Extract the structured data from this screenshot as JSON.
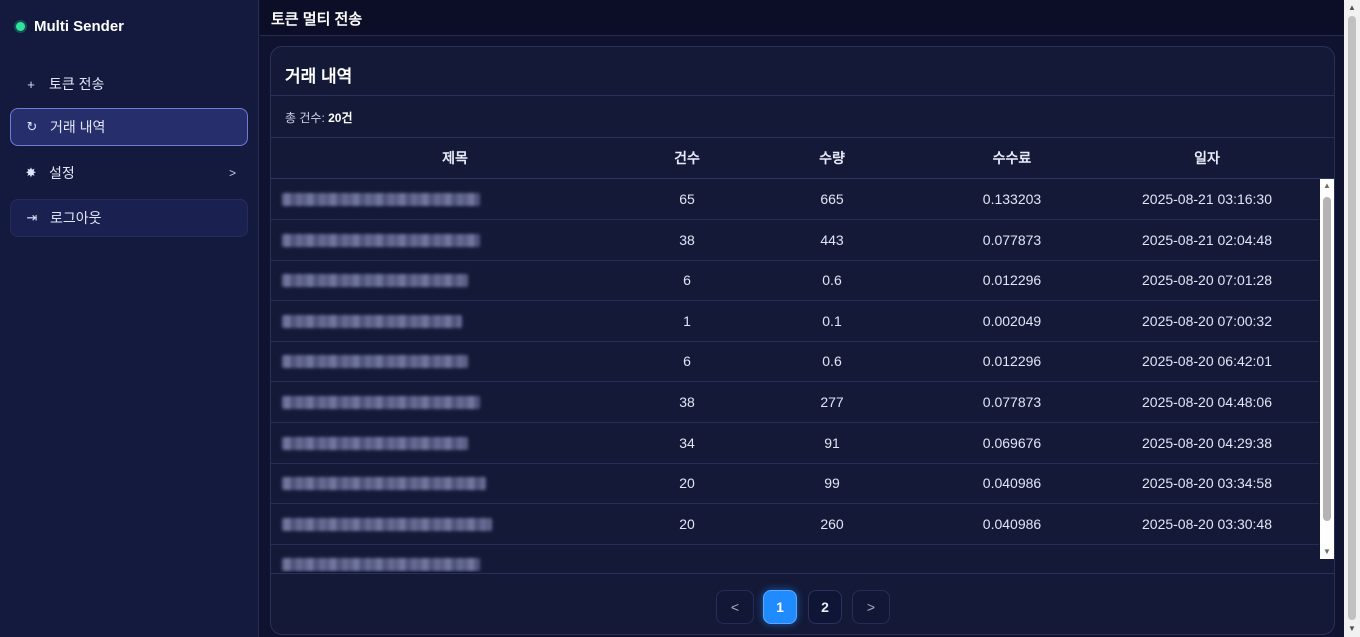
{
  "app": {
    "brand": "Multi Sender",
    "page_title": "토큰 멀티 전송"
  },
  "colors": {
    "accent": "#1f8bff",
    "status_dot": "#2ee59d",
    "background": "#0f1330"
  },
  "sidebar": {
    "items": [
      {
        "label": "토큰 전송",
        "icon": "plus-icon",
        "glyph": "+"
      },
      {
        "label": "거래 내역",
        "icon": "history-icon",
        "glyph": "↻"
      },
      {
        "label": "설정",
        "icon": "gear-icon",
        "glyph": "✸",
        "chevron": ">"
      },
      {
        "label": "로그아웃",
        "icon": "logout-icon",
        "glyph": "⇥"
      }
    ]
  },
  "history": {
    "title": "거래 내역",
    "total_label": "총 건수: ",
    "total_value": "20건",
    "columns": [
      "제목",
      "건수",
      "수량",
      "수수료",
      "일자"
    ],
    "rows": [
      {
        "count": "65",
        "amount": "665",
        "fee": "0.133203",
        "date": "2025-08-21 03:16:30"
      },
      {
        "count": "38",
        "amount": "443",
        "fee": "0.077873",
        "date": "2025-08-21 02:04:48"
      },
      {
        "count": "6",
        "amount": "0.6",
        "fee": "0.012296",
        "date": "2025-08-20 07:01:28"
      },
      {
        "count": "1",
        "amount": "0.1",
        "fee": "0.002049",
        "date": "2025-08-20 07:00:32"
      },
      {
        "count": "6",
        "amount": "0.6",
        "fee": "0.012296",
        "date": "2025-08-20 06:42:01"
      },
      {
        "count": "38",
        "amount": "277",
        "fee": "0.077873",
        "date": "2025-08-20 04:48:06"
      },
      {
        "count": "34",
        "amount": "91",
        "fee": "0.069676",
        "date": "2025-08-20 04:29:38"
      },
      {
        "count": "20",
        "amount": "99",
        "fee": "0.040986",
        "date": "2025-08-20 03:34:58"
      },
      {
        "count": "20",
        "amount": "260",
        "fee": "0.040986",
        "date": "2025-08-20 03:30:48"
      },
      {
        "count": "",
        "amount": "",
        "fee": "",
        "date": ""
      }
    ]
  },
  "pagination": {
    "prev": "<",
    "next": ">",
    "pages": [
      "1",
      "2"
    ],
    "current": "1"
  }
}
